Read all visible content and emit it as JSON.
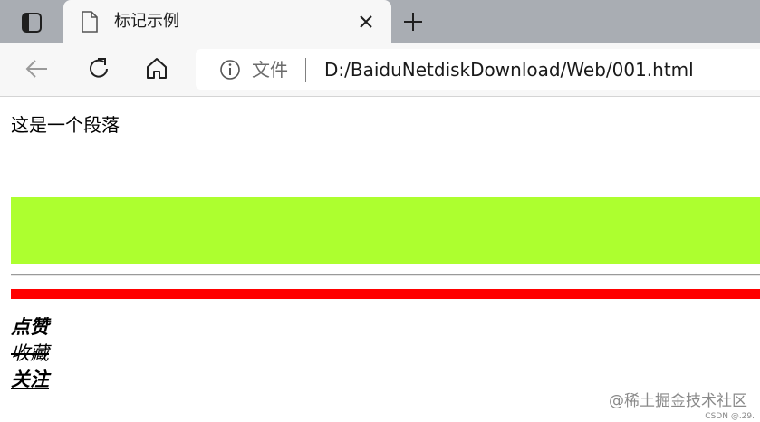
{
  "browser": {
    "tab": {
      "title": "标记示例"
    },
    "address": {
      "file_label": "文件",
      "url": "D:/BaiduNetdiskDownload/Web/001.html"
    },
    "icons": {
      "tab_switch": "tab-actions-icon",
      "page": "page-icon",
      "close": "close-icon",
      "new_tab": "plus-icon",
      "back": "back-arrow-icon",
      "reload": "reload-icon",
      "home": "home-icon",
      "info": "info-icon"
    }
  },
  "page": {
    "paragraph": "这是一个段落",
    "green_block_color": "#adff2f",
    "red_rule_color": "#ff0000",
    "actions": {
      "like": "点赞",
      "favorite": "收藏",
      "follow": "关注"
    }
  },
  "watermark": {
    "text": "@稀土掘金技术社区",
    "csdn": "CSDN @.29."
  }
}
